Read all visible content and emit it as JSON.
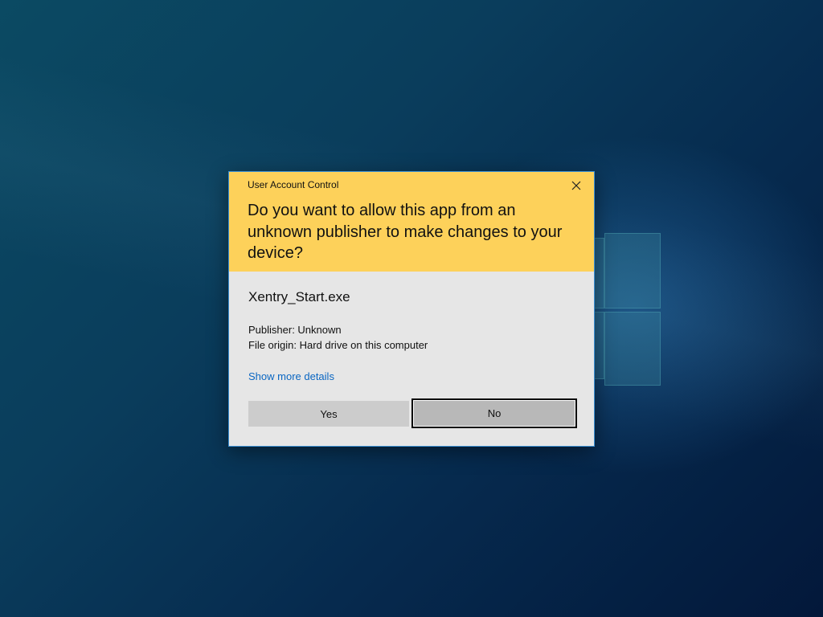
{
  "dialog": {
    "title": "User Account Control",
    "question": "Do you want to allow this app from an unknown publisher to make changes to your device?",
    "app_name": "Xentry_Start.exe",
    "publisher": "Publisher: Unknown",
    "file_origin": "File origin: Hard drive on this computer",
    "details_link": "Show more details",
    "yes_label": "Yes",
    "no_label": "No",
    "close_icon": "close-icon"
  },
  "colors": {
    "header": "#fdd15a",
    "body": "#e6e6e6",
    "link": "#0a66c2",
    "button": "#cccccc",
    "desktop": "#0a3d5c"
  }
}
